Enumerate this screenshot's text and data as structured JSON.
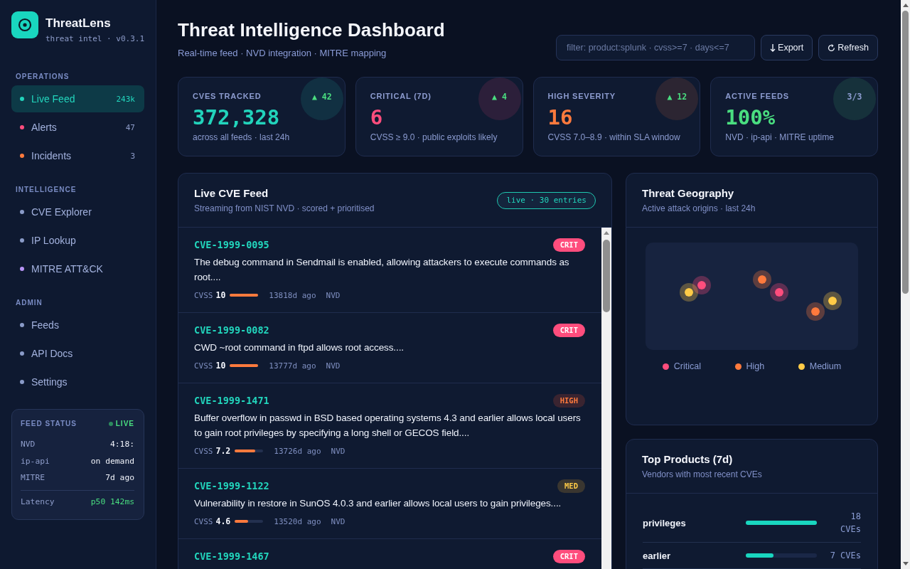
{
  "sidebar": {
    "brand": {
      "name": "ThreatLens",
      "tagline": "threat intel · v0.3.1"
    },
    "sections": [
      {
        "title": "OPERATIONS",
        "items": [
          {
            "label": "Live Feed",
            "count": "243k",
            "selected": true,
            "color": "#22d3bb"
          },
          {
            "label": "Alerts",
            "count": "47",
            "selected": false,
            "color": "#ff4d7d"
          },
          {
            "label": "Incidents",
            "count": "3",
            "selected": false,
            "color": "#ff7a3d"
          }
        ]
      },
      {
        "title": "INTELLIGENCE",
        "items": [
          {
            "label": "CVE Explorer",
            "selected": false,
            "color": "#8a9bc8"
          },
          {
            "label": "IP Lookup",
            "selected": false,
            "color": "#8a9bc8"
          },
          {
            "label": "MITRE ATT&CK",
            "selected": false,
            "color": "#b794f6"
          }
        ]
      },
      {
        "title": "ADMIN",
        "items": [
          {
            "label": "Feeds",
            "selected": false,
            "color": "#8a9bc8"
          },
          {
            "label": "API Docs",
            "selected": false,
            "color": "#8a9bc8"
          },
          {
            "label": "Settings",
            "selected": false,
            "color": "#8a9bc8"
          }
        ]
      }
    ],
    "feed_status": {
      "title": "FEED STATUS",
      "state": "LIVE",
      "rows": [
        {
          "name": "NVD",
          "value": "4:18:"
        },
        {
          "name": "ip-api",
          "value": "on demand"
        },
        {
          "name": "MITRE",
          "value": "7d ago"
        }
      ],
      "latency": {
        "name": "Latency",
        "value": "p50 142ms"
      }
    }
  },
  "header": {
    "title": "Threat Intelligence Dashboard",
    "subtitle": "Real-time feed · NVD integration · MITRE mapping",
    "filter": {
      "placeholder": "filter: product:splunk · cvss>=7 · days<=7"
    },
    "buttons": [
      {
        "kind": "export",
        "label": "Export"
      },
      {
        "kind": "refresh",
        "label": "Refresh"
      }
    ]
  },
  "stats": [
    {
      "kind": "up",
      "label": "CVES TRACKED",
      "value": "372,328",
      "note": "across all feeds · last 24h",
      "delta": "▲ 42",
      "color": "#22d3bb"
    },
    {
      "kind": "up",
      "label": "CRITICAL (7D)",
      "value": "6",
      "note": "CVSS ≥ 9.0 · public exploits likely",
      "delta": "▲ 4",
      "color": "#ff4d7d"
    },
    {
      "kind": "up",
      "label": "HIGH SEVERITY",
      "value": "16",
      "note": "CVSS 7.0–8.9 · within SLA window",
      "delta": "▲ 12",
      "color": "#ff7a3d"
    },
    {
      "kind": "flat",
      "label": "ACTIVE FEEDS",
      "value": "100%",
      "note": "NVD · ip-api · MITRE uptime",
      "delta": "3/3",
      "color": "#4ade80"
    }
  ],
  "feed": {
    "title": "Live CVE Feed",
    "subtitle": "Streaming from NIST NVD · scored + prioritised",
    "badge": "live · 30 entries",
    "entries": [
      {
        "kind": "crit",
        "id": "CVE-1999-0095",
        "badge": "CRIT",
        "description": "The debug command in Sendmail is enabled, allowing attackers to execute commands as root....",
        "cvss_label": "CVSS",
        "score": "10",
        "level": 1,
        "age": "13818d ago",
        "source": "NVD"
      },
      {
        "kind": "crit",
        "id": "CVE-1999-0082",
        "badge": "CRIT",
        "description": "CWD ~root command in ftpd allows root access....",
        "cvss_label": "CVSS",
        "score": "10",
        "level": 1,
        "age": "13777d ago",
        "source": "NVD"
      },
      {
        "kind": "high",
        "id": "CVE-1999-1471",
        "badge": "HIGH",
        "description": "Buffer overflow in passwd in BSD based operating systems 4.3 and earlier allows local users to gain root privileges by specifying a long shell or GECOS field....",
        "cvss_label": "CVSS",
        "score": "7.2",
        "level": 0.72,
        "age": "13726d ago",
        "source": "NVD"
      },
      {
        "kind": "med",
        "id": "CVE-1999-1122",
        "badge": "MED",
        "description": "Vulnerability in restore in SunOS 4.0.3 and earlier allows local users to gain privileges....",
        "cvss_label": "CVSS",
        "score": "4.6",
        "level": 0.46,
        "age": "13520d ago",
        "source": "NVD"
      },
      {
        "kind": "crit",
        "id": "CVE-1999-1467",
        "badge": "CRIT"
      }
    ]
  },
  "geography": {
    "title": "Threat Geography",
    "subtitle": "Active attack origins · last 24h",
    "pins": [
      {
        "color": "#ff4d7d"
      },
      {
        "color": "#ffcb47"
      },
      {
        "color": "#ff7a3d"
      },
      {
        "color": "#ff4d7d"
      },
      {
        "color": "#ff7a3d"
      },
      {
        "color": "#ffcb47"
      }
    ],
    "legend": [
      {
        "label": "Critical",
        "color": "#ff4d7d"
      },
      {
        "label": "High",
        "color": "#ff7a3d"
      },
      {
        "label": "Medium",
        "color": "#ffcb47"
      }
    ]
  },
  "top_products": {
    "title": "Top Products (7d)",
    "subtitle": "Vendors with most recent CVEs",
    "rows": [
      {
        "name": "privileges",
        "level": 1,
        "count": "18 CVEs"
      },
      {
        "name": "earlier",
        "level": 0.39,
        "count": "7 CVEs"
      }
    ]
  }
}
